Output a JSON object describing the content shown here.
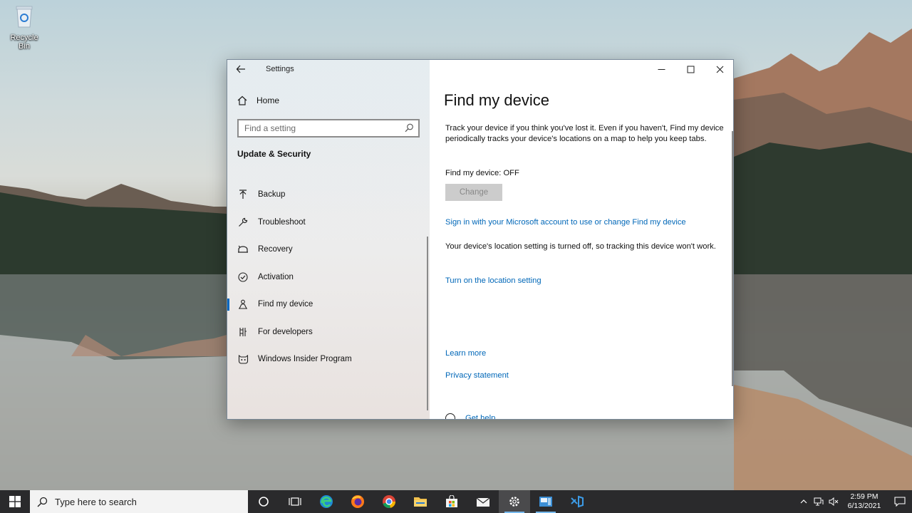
{
  "desktop": {
    "recycle_bin_label": "Recycle Bin"
  },
  "window": {
    "title": "Settings",
    "controls": [
      "minimize",
      "maximize",
      "close"
    ]
  },
  "nav": {
    "home_label": "Home",
    "search_placeholder": "Find a setting",
    "section_title": "Update & Security",
    "items": [
      {
        "label": "Backup",
        "icon": "backup-icon",
        "active": false
      },
      {
        "label": "Troubleshoot",
        "icon": "wrench-icon",
        "active": false
      },
      {
        "label": "Recovery",
        "icon": "recovery-icon",
        "active": false
      },
      {
        "label": "Activation",
        "icon": "check-circle-icon",
        "active": false
      },
      {
        "label": "Find my device",
        "icon": "person-pin-icon",
        "active": true
      },
      {
        "label": "For developers",
        "icon": "developer-tools-icon",
        "active": false
      },
      {
        "label": "Windows Insider Program",
        "icon": "insider-cat-icon",
        "active": false
      }
    ]
  },
  "content": {
    "title": "Find my device",
    "description": "Track your device if you think you've lost it. Even if you haven't, Find my device periodically tracks your device's locations on a map to help you keep tabs.",
    "status": "Find my device: OFF",
    "change_button": "Change",
    "sign_in_link": "Sign in with your Microsoft account to use or change Find my device",
    "location_note": "Your device's location setting is turned off, so tracking this device won't work.",
    "location_link": "Turn on the location setting",
    "learn_more": "Learn more",
    "privacy": "Privacy statement",
    "get_help": "Get help"
  },
  "taskbar": {
    "search_placeholder": "Type here to search",
    "apps": [
      {
        "name": "cortana-icon",
        "open": false,
        "active": false
      },
      {
        "name": "task-view-icon",
        "open": false,
        "active": false
      },
      {
        "name": "edge-icon",
        "open": false,
        "active": false
      },
      {
        "name": "firefox-icon",
        "open": false,
        "active": false
      },
      {
        "name": "chrome-icon",
        "open": false,
        "active": false
      },
      {
        "name": "file-explorer-icon",
        "open": false,
        "active": false
      },
      {
        "name": "store-icon",
        "open": false,
        "active": false
      },
      {
        "name": "mail-icon",
        "open": false,
        "active": false
      },
      {
        "name": "settings-icon",
        "open": true,
        "active": true
      },
      {
        "name": "app-icon",
        "open": true,
        "active": false
      },
      {
        "name": "visual-studio-icon",
        "open": false,
        "active": false
      }
    ],
    "time": "2:59 PM",
    "date": "6/13/2021"
  },
  "colors": {
    "accent": "#0067c0",
    "link": "#0067b8",
    "taskbar": "#2a2a2c"
  }
}
